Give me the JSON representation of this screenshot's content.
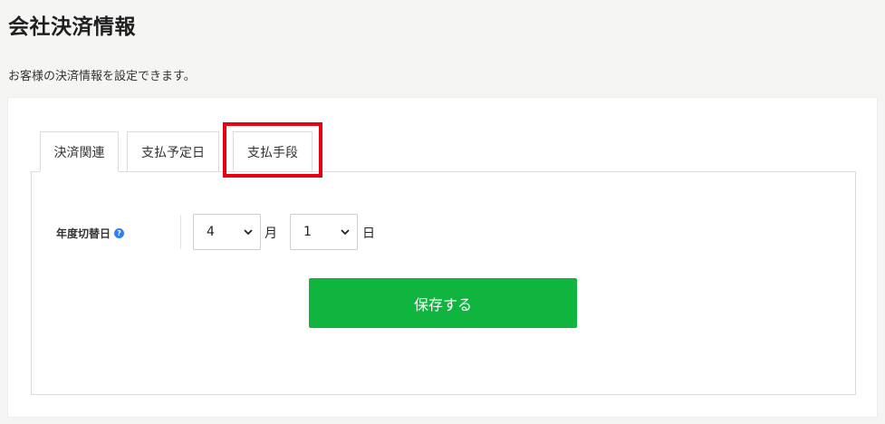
{
  "page": {
    "title": "会社決済情報",
    "description": "お客様の決済情報を設定できます。"
  },
  "tabs": [
    {
      "label": "決済関連",
      "active": true
    },
    {
      "label": "支払予定日",
      "active": false
    },
    {
      "label": "支払手段",
      "active": false,
      "highlighted": true
    }
  ],
  "form": {
    "fiscal_year_label": "年度切替日",
    "help_icon": "question-circle-icon",
    "month_value": "4",
    "month_unit": "月",
    "day_value": "1",
    "day_unit": "日",
    "save_label": "保存する"
  },
  "colors": {
    "accent_green": "#10b53f",
    "highlight_red": "#e60012",
    "help_blue": "#2d7ff9"
  }
}
